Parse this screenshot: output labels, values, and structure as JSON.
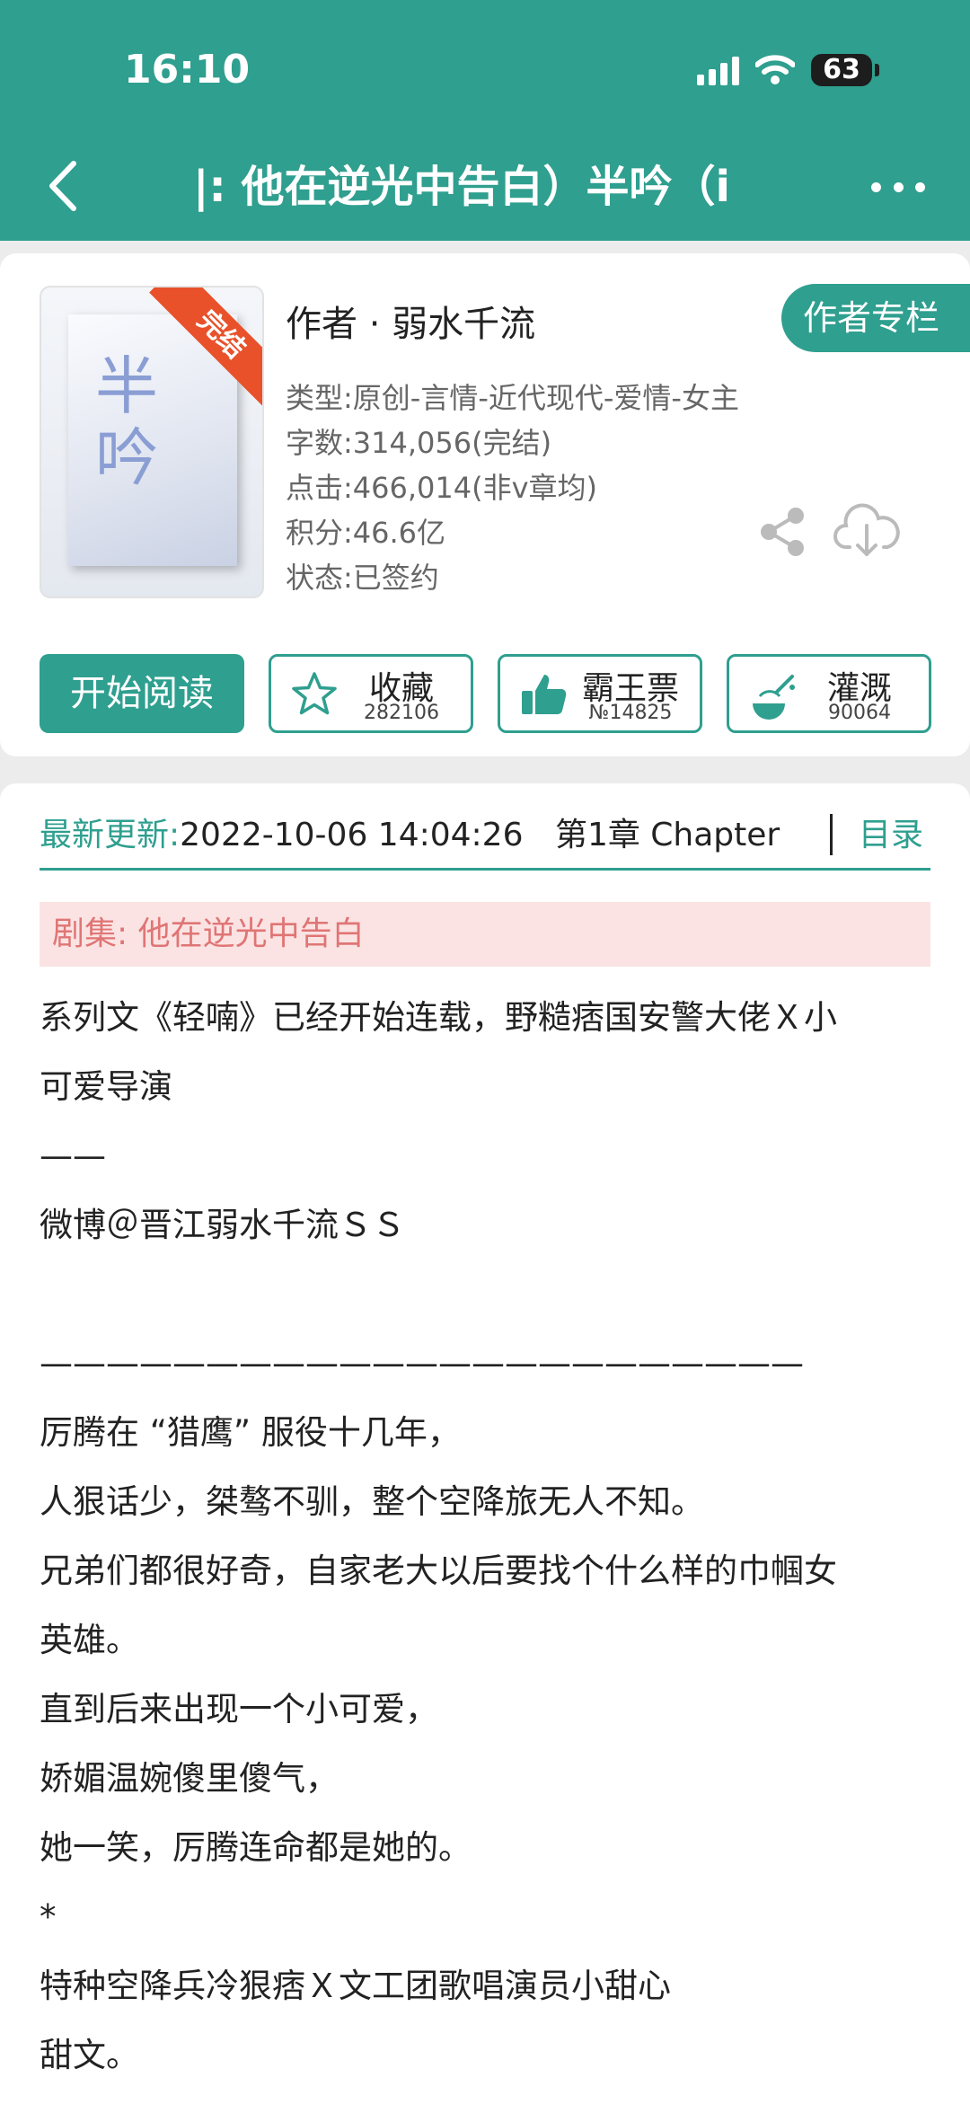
{
  "status_bar": {
    "time": "16:10",
    "battery": "63"
  },
  "nav": {
    "title": "|: 他在逆光中告白）半吟（i"
  },
  "book": {
    "cover_badge": "完结",
    "cover_title": "半吟",
    "author": "作者 · 弱水千流",
    "author_column_label": "作者专栏",
    "meta": [
      "类型:原创-言情-近代现代-爱情-女主",
      "字数:314,056(完结)",
      "点击:466,014(非v章均)",
      "积分:46.6亿",
      "状态:已签约"
    ]
  },
  "actions": {
    "read_label": "开始阅读",
    "favorite": {
      "label": "收藏",
      "count": "282106"
    },
    "vote": {
      "label": "霸王票",
      "count": "№14825"
    },
    "water": {
      "label": "灌溉",
      "count": "90064"
    }
  },
  "update": {
    "label": "最新更新:",
    "datetime": "2022-10-06 14:04:26",
    "chapter": "第1章 Chapter",
    "toc_label": "目录"
  },
  "series": "剧集: 他在逆光中告白",
  "intro_lines": [
    "系列文《轻喃》已经开始连载，野糙痞国安警大佬Ｘ小",
    "可爱导演",
    "——",
    "微博＠晋江弱水千流ＳＳ",
    "",
    "———————————————————————",
    "厉腾在 “猎鹰” 服役十几年，",
    "人狠话少，桀骜不驯，整个空降旅无人不知。",
    "兄弟们都很好奇，自家老大以后要找个什么样的巾帼女",
    "英雄。",
    "直到后来出现一个小可爱，",
    "娇媚温婉傻里傻气，",
    "她一笑，厉腾连命都是她的。",
    "*",
    "特种空降兵冷狠痞Ｘ文工团歌唱演员小甜心",
    "甜文。"
  ]
}
